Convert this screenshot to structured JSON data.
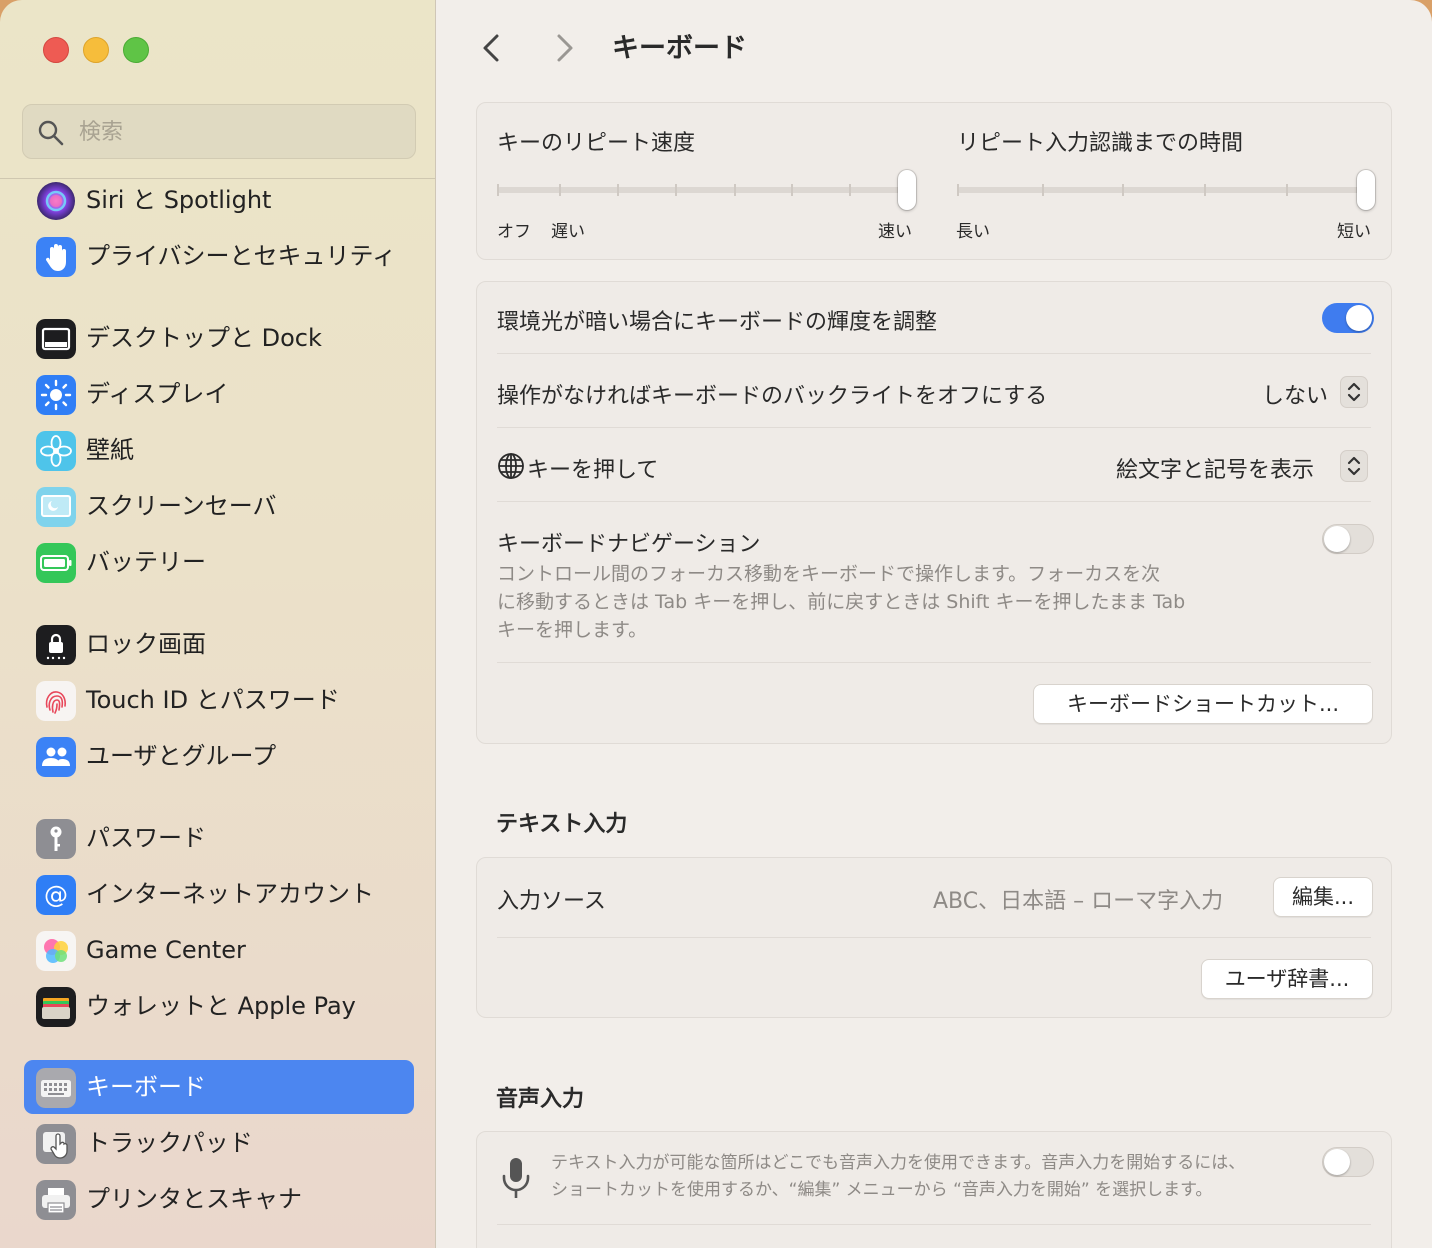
{
  "sidebar": {
    "search_placeholder": "検索",
    "items": [
      {
        "label": "Siri と Spotlight",
        "icon": "siri-icon"
      },
      {
        "label": "プライバシーとセキュリティ",
        "icon": "hand-icon"
      },
      {
        "label": "デスクトップと Dock",
        "icon": "desktop-dock-icon"
      },
      {
        "label": "ディスプレイ",
        "icon": "display-sun-icon"
      },
      {
        "label": "壁紙",
        "icon": "wallpaper-flower-icon"
      },
      {
        "label": "スクリーンセーバ",
        "icon": "screensaver-icon"
      },
      {
        "label": "バッテリー",
        "icon": "battery-icon"
      },
      {
        "label": "ロック画面",
        "icon": "lock-icon"
      },
      {
        "label": "Touch ID とパスワード",
        "icon": "fingerprint-icon"
      },
      {
        "label": "ユーザとグループ",
        "icon": "users-icon"
      },
      {
        "label": "パスワード",
        "icon": "key-icon"
      },
      {
        "label": "インターネットアカウント",
        "icon": "at-icon"
      },
      {
        "label": "Game Center",
        "icon": "game-center-icon"
      },
      {
        "label": "ウォレットと Apple Pay",
        "icon": "wallet-icon"
      },
      {
        "label": "キーボード",
        "icon": "keyboard-icon",
        "selected": true
      },
      {
        "label": "トラックパッド",
        "icon": "trackpad-icon"
      },
      {
        "label": "プリンタとスキャナ",
        "icon": "printer-icon"
      }
    ]
  },
  "header": {
    "title": "キーボード"
  },
  "repeat": {
    "rate_label": "キーのリピート速度",
    "rate_off": "オフ",
    "rate_slow": "遅い",
    "rate_fast": "速い",
    "rate_value_fraction": 1.0,
    "delay_label": "リピート入力認識までの時間",
    "delay_long": "長い",
    "delay_short": "短い",
    "delay_value_fraction": 1.0
  },
  "settings": {
    "ambient_label": "環境光が暗い場合にキーボードの輝度を調整",
    "ambient_on": true,
    "backlight_label": "操作がなければキーボードのバックライトをオフにする",
    "backlight_value": "しない",
    "globe_label": "キーを押して",
    "globe_value": "絵文字と記号を表示",
    "nav_label": "キーボードナビゲーション",
    "nav_on": false,
    "nav_desc_1": "コントロール間のフォーカス移動をキーボードで操作します。フォーカスを次",
    "nav_desc_2": "に移動するときは Tab キーを押し、前に戻すときは Shift キーを押したまま Tab",
    "nav_desc_3": "キーを押します。",
    "shortcuts_button": "キーボードショートカット..."
  },
  "text_input": {
    "section_title": "テキスト入力",
    "sources_label": "入力ソース",
    "sources_value": "ABC、日本語 – ローマ字入力",
    "edit_button": "編集...",
    "dictionary_button": "ユーザ辞書..."
  },
  "dictation": {
    "section_title": "音声入力",
    "desc_1": "テキスト入力が可能な箇所はどこでも音声入力を使用できます。音声入力を開始するには、",
    "desc_2": "ショートカットを使用するか、“編集” メニューから “音声入力を開始” を選択します。",
    "on": false
  },
  "colors": {
    "accent": "#3f7cef",
    "selection": "#4c86f0"
  }
}
